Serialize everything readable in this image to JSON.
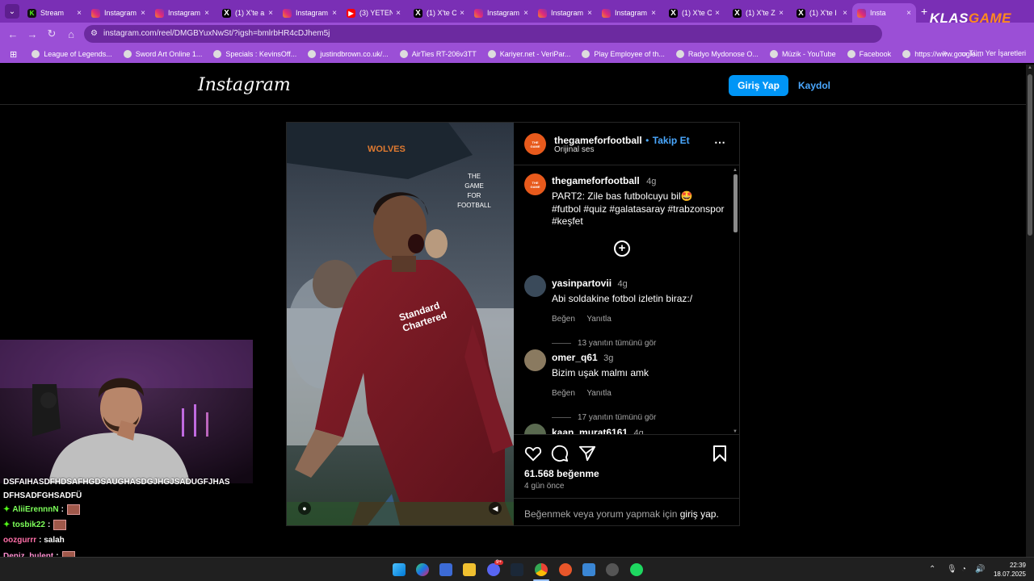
{
  "browser": {
    "tab_menu_icon": "chevron-down-icon",
    "tabs": [
      {
        "title": "Stream",
        "icon": "kick"
      },
      {
        "title": "Instagram",
        "icon": "instagram"
      },
      {
        "title": "Instagram",
        "icon": "instagram"
      },
      {
        "title": "(1) X'te a",
        "icon": "x"
      },
      {
        "title": "Instagram",
        "icon": "instagram"
      },
      {
        "title": "(3) YETEN",
        "icon": "youtube"
      },
      {
        "title": "(1) X'te C",
        "icon": "x"
      },
      {
        "title": "Instagram",
        "icon": "instagram"
      },
      {
        "title": "Instagram",
        "icon": "instagram"
      },
      {
        "title": "Instagram",
        "icon": "instagram"
      },
      {
        "title": "(1) X'te C",
        "icon": "x"
      },
      {
        "title": "(1) X'te Z",
        "icon": "x"
      },
      {
        "title": "(1) X'te I",
        "icon": "x"
      },
      {
        "title": "Insta",
        "icon": "instagram",
        "active": true
      }
    ],
    "overlay_brand": {
      "part1": "KLAS",
      "part2": "GAME"
    },
    "url": "instagram.com/reel/DMGBYuxNwSt/?igsh=bmlrbHR4cDJhem5j",
    "bookmarks": [
      "League of Legends...",
      "Sword Art Online 1...",
      "Specials : KevinsOff...",
      "justindbrown.co.uk/...",
      "AirTies RT-206v3TT",
      "Kariyer.net - VeriPar...",
      "Play Employee of th...",
      "Radyo Mydonose O...",
      "Müzik - YouTube",
      "Facebook",
      "https://www.google..."
    ],
    "all_bookmarks": "Tüm Yer İşaretleri",
    "accent": "#9b4fd6"
  },
  "instagram": {
    "logo": "Instagram",
    "login_button": "Giriş Yap",
    "signup_link": "Kaydol",
    "post": {
      "video": {
        "team_text": "WOLVES",
        "watermark": [
          "THE",
          "GAME",
          "FOR",
          "FOOTBALL"
        ],
        "shirt_sponsor": [
          "Standard",
          "Chartered"
        ]
      },
      "author": "thegameforfootball",
      "follow_separator": "•",
      "follow": "Takip Et",
      "audio": "Orijinal ses",
      "caption": {
        "username": "thegameforfootball",
        "time": "4g",
        "text": "PART2: Zile bas futbolcuyu bil🤩",
        "hashtags": [
          "#futbol",
          "#quiz",
          "#galatasaray",
          "#trabzonspor",
          "#keşfet"
        ]
      },
      "comments": [
        {
          "username": "yasinpartovii",
          "time": "4g",
          "text": "Abi soldakine fotbol izletin biraz:/",
          "like": "Beğen",
          "reply": "Yanıtla",
          "replies": "13 yanıtın tümünü gör"
        },
        {
          "username": "omer_q61",
          "time": "3g",
          "text": "Bizim uşak malmı amk",
          "like": "Beğen",
          "reply": "Yanıtla",
          "replies": "17 yanıtın tümünü gör"
        },
        {
          "username": "kaan_murat6161",
          "time": "4g"
        }
      ],
      "likes": "61.568 beğenme",
      "posted": "4 gün önce",
      "login_prompt_prefix": "Beğenmek veya yorum yapmak için ",
      "login_prompt_link": "giriş yap",
      "login_prompt_suffix": "."
    }
  },
  "chat": [
    {
      "user": "",
      "text": "DSFAIHASDFHDSAFHGDSAUGHASDGJHGJSADUGFJHAS",
      "color": "#ffffff"
    },
    {
      "user": "",
      "text": "DFHSADFGHSADFÜ",
      "color": "#ffffff"
    },
    {
      "user": "AliiErennnN",
      "text": ":",
      "color": "#7dff5a",
      "badge": true,
      "emote": true
    },
    {
      "user": "tosbik22",
      "text": ":",
      "color": "#7dff5a",
      "badge": true,
      "emote": true
    },
    {
      "user": "oozgurrr",
      "text": ": salah",
      "color": "#ff6fa8"
    },
    {
      "user": "Deniz_bulent",
      "text": ":",
      "color": "#ff8fd0",
      "emote": true
    }
  ],
  "taskbar": {
    "time": "22:39",
    "date": "18.07.2025",
    "discord_badge": "9+"
  }
}
